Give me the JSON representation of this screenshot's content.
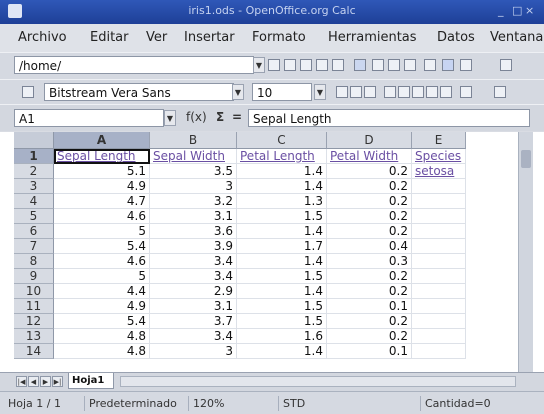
{
  "window": {
    "title": "iris1.ods - OpenOffice.org Calc"
  },
  "menu": [
    "Archivo",
    "Editar",
    "Ver",
    "Insertar",
    "Formato",
    "Herramientas",
    "Datos",
    "Ventana"
  ],
  "toolbar": {
    "path": "/home/",
    "font_name": "Bitstream Vera Sans",
    "font_size": "10"
  },
  "formula": {
    "cell_ref": "A1",
    "fx_label": "f(x)",
    "sum_label": "Σ",
    "equals_label": "=",
    "content": "Sepal Length"
  },
  "sheet": {
    "columns": [
      "A",
      "B",
      "C",
      "D",
      "E"
    ],
    "row_numbers": [
      "1",
      "2",
      "3",
      "4",
      "5",
      "6",
      "7",
      "8",
      "9",
      "10",
      "11",
      "12",
      "13",
      "14"
    ],
    "header_row": [
      "Sepal Length",
      "Sepal Width",
      "Petal Length",
      "Petal Width",
      "Species"
    ],
    "rows": [
      [
        "5.1",
        "3.5",
        "1.4",
        "0.2",
        "setosa"
      ],
      [
        "4.9",
        "3",
        "1.4",
        "0.2",
        ""
      ],
      [
        "4.7",
        "3.2",
        "1.3",
        "0.2",
        ""
      ],
      [
        "4.6",
        "3.1",
        "1.5",
        "0.2",
        ""
      ],
      [
        "5",
        "3.6",
        "1.4",
        "0.2",
        ""
      ],
      [
        "5.4",
        "3.9",
        "1.7",
        "0.4",
        ""
      ],
      [
        "4.6",
        "3.4",
        "1.4",
        "0.3",
        ""
      ],
      [
        "5",
        "3.4",
        "1.5",
        "0.2",
        ""
      ],
      [
        "4.4",
        "2.9",
        "1.4",
        "0.2",
        ""
      ],
      [
        "4.9",
        "3.1",
        "1.5",
        "0.1",
        ""
      ],
      [
        "5.4",
        "3.7",
        "1.5",
        "0.2",
        ""
      ],
      [
        "4.8",
        "3.4",
        "1.6",
        "0.2",
        ""
      ],
      [
        "4.8",
        "3",
        "1.4",
        "0.1",
        ""
      ]
    ],
    "tab_name": "Hoja1"
  },
  "status": {
    "sheet_info": "Hoja 1 / 1",
    "page_style": "Predeterminado",
    "zoom": "120%",
    "mode": "STD",
    "selection": "Cantidad=0"
  }
}
